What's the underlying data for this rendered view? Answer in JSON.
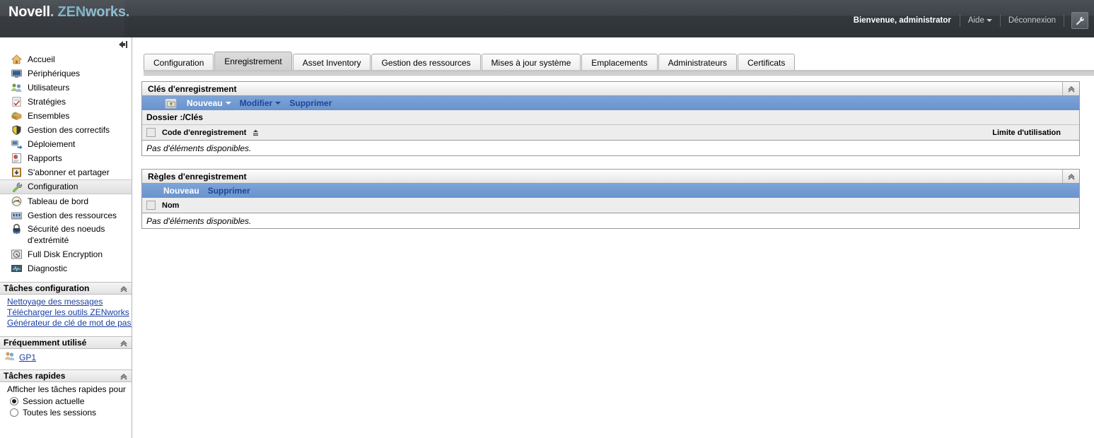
{
  "header": {
    "brand_novell": "Novell",
    "brand_dot": ".",
    "brand_zen": "ZEN",
    "brand_works": "works",
    "brand_dot2": ".",
    "welcome": "Bienvenue, administrator",
    "help_label": "Aide",
    "logout_label": "Déconnexion",
    "wrench_icon": "wrench-icon"
  },
  "sidebar": {
    "collapse_icon": "collapse-panel-icon",
    "items": [
      {
        "label": "Accueil",
        "icon": "home-icon"
      },
      {
        "label": "Périphériques",
        "icon": "monitor-icon"
      },
      {
        "label": "Utilisateurs",
        "icon": "users-icon"
      },
      {
        "label": "Stratégies",
        "icon": "clipboard-check-icon"
      },
      {
        "label": "Ensembles",
        "icon": "box-icon"
      },
      {
        "label": "Gestion des correctifs",
        "icon": "shield-icon"
      },
      {
        "label": "Déploiement",
        "icon": "deploy-icon"
      },
      {
        "label": "Rapports",
        "icon": "report-chart-icon"
      },
      {
        "label": "S'abonner et partager",
        "icon": "download-box-icon"
      },
      {
        "label": "Configuration",
        "icon": "wrench-icon",
        "selected": true
      },
      {
        "label": "Tableau de bord",
        "icon": "gauge-icon"
      },
      {
        "label": "Gestion des ressources",
        "icon": "asset-icon"
      },
      {
        "label": "Sécurité des noeuds d'extrémité",
        "icon": "lock-icon",
        "two_line": true
      },
      {
        "label": "Full Disk Encryption",
        "icon": "disk-icon"
      },
      {
        "label": "Diagnostic",
        "icon": "pulse-icon"
      }
    ],
    "sections": [
      {
        "title": "Tâches configuration",
        "collapse_icon": "chevron-up-icon",
        "links": [
          "Nettoyage des messages",
          "Télécharger les outils ZENworks",
          "Générateur de clé de mot de passe"
        ]
      },
      {
        "title": "Fréquemment utilisé",
        "collapse_icon": "chevron-up-icon",
        "freq_items": [
          {
            "label": "GP1",
            "icon": "group-icon"
          }
        ]
      },
      {
        "title": "Tâches rapides",
        "collapse_icon": "chevron-up-icon",
        "description": "Afficher les tâches rapides pour",
        "options": [
          {
            "label": "Session actuelle",
            "selected": true
          },
          {
            "label": "Toutes les sessions",
            "selected": false
          }
        ]
      }
    ]
  },
  "tabs": [
    {
      "label": "Configuration",
      "active": false
    },
    {
      "label": "Enregistrement",
      "active": true
    },
    {
      "label": "Asset Inventory",
      "active": false
    },
    {
      "label": "Gestion des ressources",
      "active": false
    },
    {
      "label": "Mises à jour système",
      "active": false
    },
    {
      "label": "Emplacements",
      "active": false
    },
    {
      "label": "Administrateurs",
      "active": false
    },
    {
      "label": "Certificats",
      "active": false
    }
  ],
  "panels": [
    {
      "title": "Clés d'enregistrement",
      "collapse_icon": "chevron-up-icon",
      "toolbar": {
        "folder_up_icon": "folder-up-icon",
        "buttons": [
          {
            "label": "Nouveau",
            "style": "primary",
            "caret": true
          },
          {
            "label": "Modifier",
            "style": "secondary",
            "caret": true
          },
          {
            "label": "Supprimer",
            "style": "secondary",
            "caret": false
          }
        ]
      },
      "folder_row": "Dossier :/Clés",
      "columns": {
        "left": "Code d'enregistrement",
        "sort_icon": "sort-ascending-icon",
        "right": "Limite d'utilisation"
      },
      "empty_text": "Pas d'éléments disponibles."
    },
    {
      "title": "Règles d'enregistrement",
      "collapse_icon": "chevron-up-icon",
      "toolbar": {
        "buttons": [
          {
            "label": "Nouveau",
            "style": "primary",
            "caret": false
          },
          {
            "label": "Supprimer",
            "style": "secondary",
            "caret": false
          }
        ]
      },
      "columns": {
        "left": "Nom",
        "right": ""
      },
      "empty_text": "Pas d'éléments disponibles."
    }
  ],
  "colors": {
    "accent_blue": "#6a93cd",
    "header_dark": "#33383c",
    "link_blue": "#1a3fa0",
    "brand_cyan": "#7fb3c9"
  }
}
